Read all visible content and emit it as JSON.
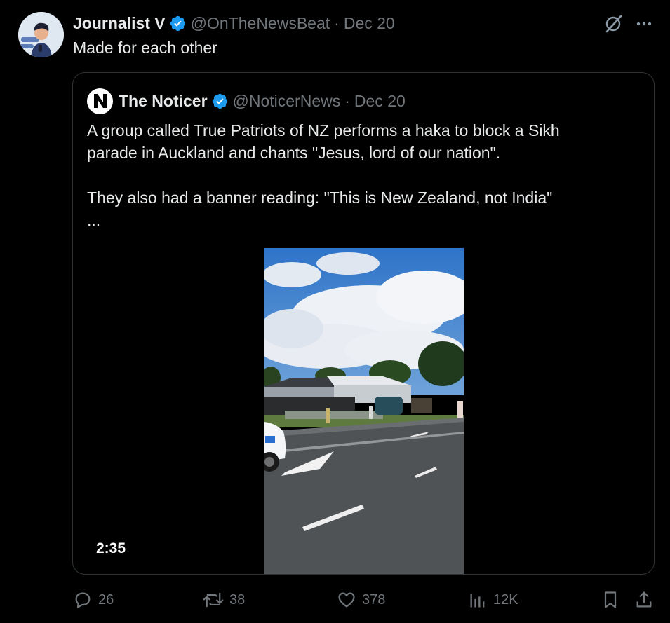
{
  "author": {
    "name": "Journalist V",
    "handle": "@OnTheNewsBeat",
    "separator": "·",
    "date": "Dec 20",
    "text": "Made for each other"
  },
  "quoted": {
    "name": "The Noticer",
    "handle": "@NoticerNews",
    "separator": "·",
    "date": "Dec 20",
    "logo_letter": "N",
    "paragraph1": "A group called True Patriots of NZ performs a haka to block a Sikh\nparade in Auckland and chants \"Jesus, lord of our nation\".",
    "paragraph2": "They also had a banner reading: \"This is New Zealand, not India\"",
    "ellipsis": "...",
    "video_duration": "2:35"
  },
  "actions": {
    "replies": "26",
    "reposts": "38",
    "likes": "378",
    "views": "12K"
  },
  "icons": {
    "verified": "verified-badge-icon",
    "grok": "grok-icon",
    "more": "more-icon",
    "reply": "reply-icon",
    "repost": "repost-icon",
    "like": "heart-icon",
    "views": "analytics-icon",
    "bookmark": "bookmark-icon",
    "share": "share-icon"
  },
  "colors": {
    "background": "#000000",
    "text": "#e7e9ea",
    "muted": "#71767b",
    "border": "#2f3336",
    "verified": "#1d9bf0"
  }
}
